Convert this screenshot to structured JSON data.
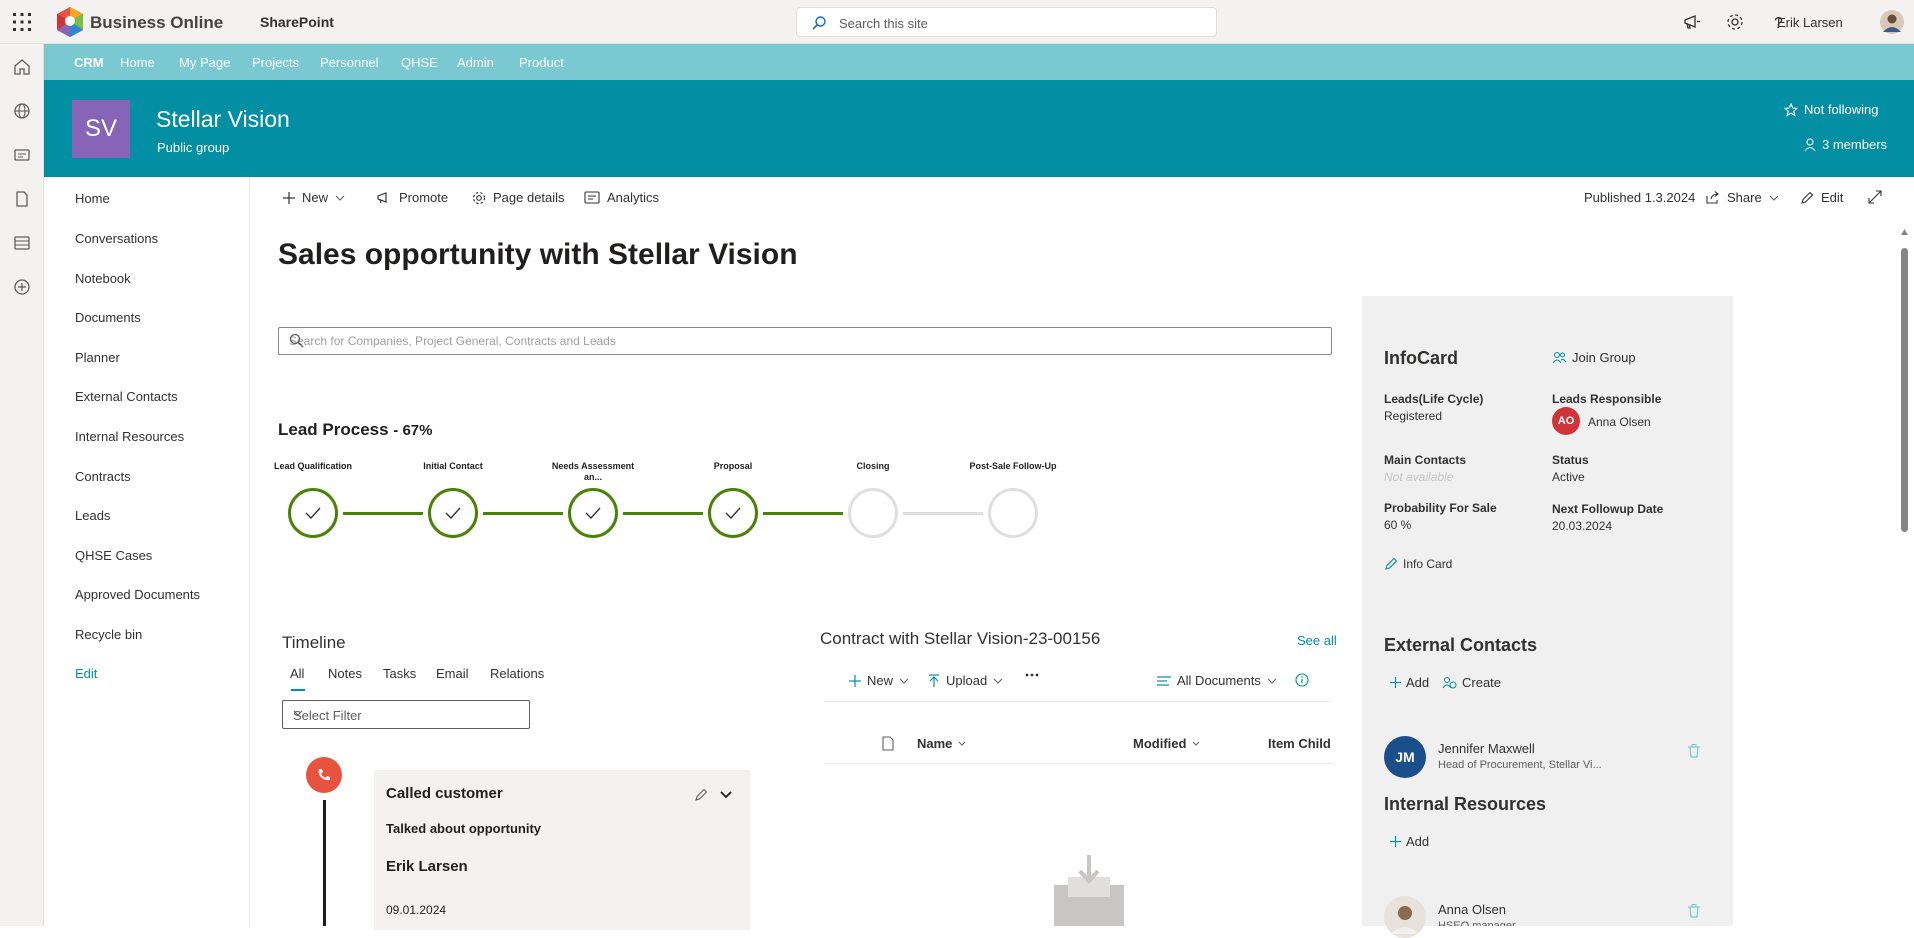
{
  "suite": {
    "brand": "Business Online",
    "app_name": "SharePoint",
    "search_placeholder": "Search this site",
    "user_name": "Erik Larsen"
  },
  "hub_nav": [
    "CRM",
    "Home",
    "My Page",
    "Projects",
    "Personnel",
    "QHSE",
    "Admin",
    "Product"
  ],
  "site": {
    "initials": "SV",
    "title": "Stellar Vision",
    "subtitle": "Public group",
    "follow_label": "Not following",
    "members_label": "3 members"
  },
  "site_nav": [
    "Home",
    "Conversations",
    "Notebook",
    "Documents",
    "Planner",
    "External Contacts",
    "Internal Resources",
    "Contracts",
    "Leads",
    "QHSE Cases",
    "Approved Documents",
    "Recycle bin",
    "Edit"
  ],
  "command_bar": {
    "new": "New",
    "promote": "Promote",
    "page_details": "Page details",
    "analytics": "Analytics",
    "published": "Published 1.3.2024",
    "share": "Share",
    "edit": "Edit"
  },
  "page": {
    "title": "Sales opportunity with Stellar Vision",
    "search_placeholder": "Search for Companies, Project General, Contracts and Leads"
  },
  "lead_process": {
    "title": "Lead Process",
    "percent": "- 67%",
    "steps": [
      {
        "label": "Lead Qualification",
        "done": true
      },
      {
        "label": "Initial Contact",
        "done": true
      },
      {
        "label": "Needs Assessment an...",
        "done": true
      },
      {
        "label": "Proposal",
        "done": true
      },
      {
        "label": "Closing",
        "done": false
      },
      {
        "label": "Post-Sale Follow-Up",
        "done": false
      }
    ]
  },
  "timeline": {
    "title": "Timeline",
    "tabs": [
      "All",
      "Notes",
      "Tasks",
      "Email",
      "Relations"
    ],
    "filter_placeholder": "Select Filter",
    "entry": {
      "title": "Called customer",
      "text": "Talked about opportunity",
      "author": "Erik Larsen",
      "date": "09.01.2024"
    }
  },
  "contract": {
    "title": "Contract with Stellar Vision-23-00156",
    "see_all": "See all",
    "new": "New",
    "upload": "Upload",
    "view": "All Documents",
    "columns": [
      "Name",
      "Modified",
      "Item Child C"
    ]
  },
  "infocard": {
    "title": "InfoCard",
    "join_group": "Join Group",
    "lifecycle_label": "Leads(Life Cycle)",
    "lifecycle_value": "Registered",
    "responsible_label": "Leads Responsible",
    "responsible_initials": "AO",
    "responsible_name": "Anna Olsen",
    "main_contacts_label": "Main Contacts",
    "main_contacts_value": "Not available",
    "status_label": "Status",
    "status_value": "Active",
    "probability_label": "Probability For Sale",
    "probability_value": "60 %",
    "followup_label": "Next Followup Date",
    "followup_value": "20.03.2024",
    "info_card_link": "Info Card"
  },
  "external_contacts": {
    "title": "External Contacts",
    "add": "Add",
    "create": "Create",
    "contact_initials": "JM",
    "contact_name": "Jennifer Maxwell",
    "contact_role": "Head of Procurement, Stellar Vi..."
  },
  "internal_resources": {
    "title": "Internal Resources",
    "add": "Add",
    "person_name": "Anna Olsen",
    "person_role": "HSEQ manager"
  },
  "colors": {
    "hub_nav": "#7ac8d1",
    "site_header": "#038fa3",
    "site_avatar": "#8764b8",
    "step_done": "#498205",
    "step_pending": "#e1dfdd",
    "call_icon": "#e8533f",
    "responsible_avatar": "#d13438",
    "contact_avatar": "#1a4f8b"
  }
}
